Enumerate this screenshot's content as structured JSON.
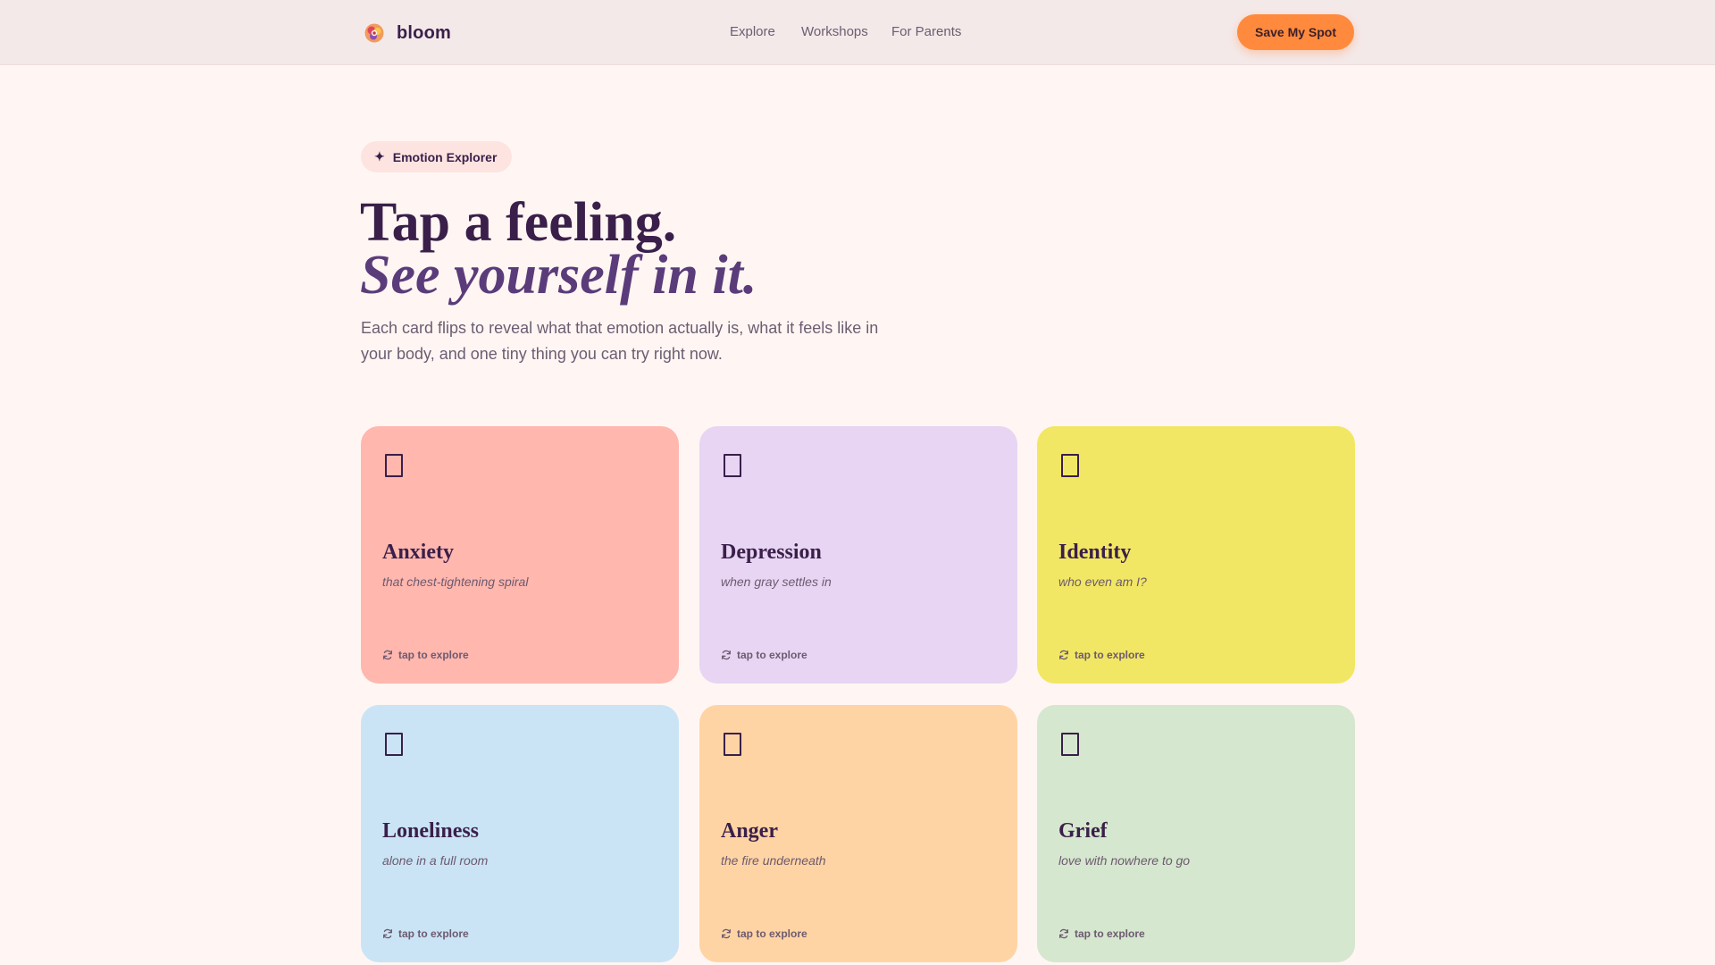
{
  "header": {
    "brand": "bloom",
    "nav": [
      "Explore",
      "Workshops",
      "For Parents"
    ],
    "cta_label": "Save My Spot"
  },
  "hero": {
    "badge_icon": "✦",
    "badge_label": "Emotion Explorer",
    "title_line1": "Tap a feeling.",
    "title_line2": "See yourself in it.",
    "lede": "Each card flips to reveal what that emotion actually is, what it feels like in your body, and one tiny thing you can try right now."
  },
  "cards": [
    {
      "title": "Anxiety",
      "subtitle": "that chest-tightening spiral",
      "hint": "tap to explore",
      "color": "#ffb7ae"
    },
    {
      "title": "Depression",
      "subtitle": "when gray settles in",
      "hint": "tap to explore",
      "color": "#e8d5f3"
    },
    {
      "title": "Identity",
      "subtitle": "who even am I?",
      "hint": "tap to explore",
      "color": "#f2e764"
    },
    {
      "title": "Loneliness",
      "subtitle": "alone in a full room",
      "hint": "tap to explore",
      "color": "#cae4f5"
    },
    {
      "title": "Anger",
      "subtitle": "the fire underneath",
      "hint": "tap to explore",
      "color": "#ffd4a4"
    },
    {
      "title": "Grief",
      "subtitle": "love with nowhere to go",
      "hint": "tap to explore",
      "color": "#d5e7ce"
    }
  ],
  "colors": {
    "background": "#fff6f3",
    "header_background": "#f4e9e9",
    "accent": "#ff8a3d",
    "ink": "#3a1f4a",
    "title_accent": "#5b3c7a",
    "muted": "#6c5d72"
  },
  "icons": {
    "logo": "bloom-logo-icon",
    "badge": "sparkle-icon",
    "card_emoji": "emoji-placeholder-icon",
    "hint": "refresh-icon"
  }
}
